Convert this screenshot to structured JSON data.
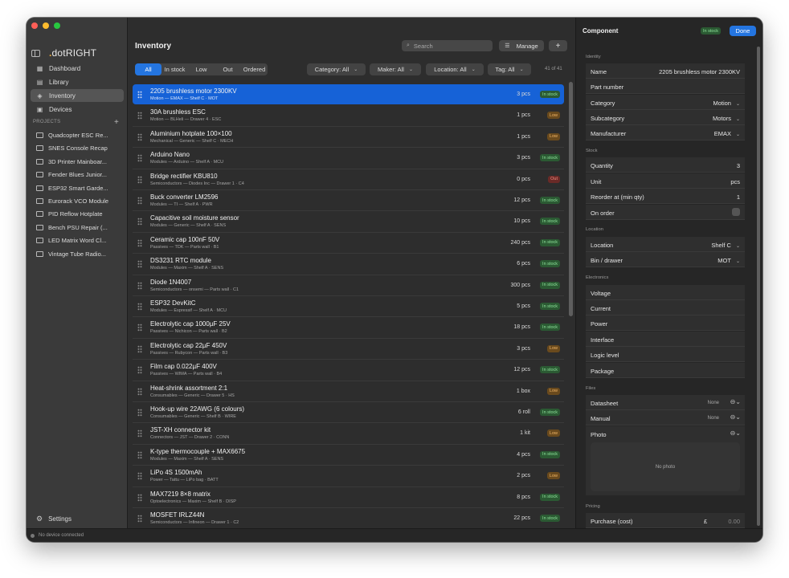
{
  "sidebar": {
    "brand": {
      "prefix": ".",
      "name": "dotRIGHT"
    },
    "nav": [
      {
        "label": "Dashboard",
        "icon": "grid-icon"
      },
      {
        "label": "Library",
        "icon": "book-icon"
      },
      {
        "label": "Inventory",
        "icon": "box-icon",
        "active": true
      },
      {
        "label": "Devices",
        "icon": "chip-icon"
      }
    ],
    "projects_title": "PROJECTS",
    "projects": [
      "Quadcopter ESC Re...",
      "SNES Console Recap",
      "3D Printer Mainboar...",
      "Fender Blues Junior...",
      "ESP32 Smart Garde...",
      "Eurorack VCO Module",
      "PID Reflow Hotplate",
      "Bench PSU Repair (...",
      "LED Matrix Word Cl...",
      "Vintage Tube Radio..."
    ],
    "settings_label": "Settings"
  },
  "status_bar": {
    "text": "No device connected"
  },
  "main": {
    "title": "Inventory",
    "search_placeholder": "Search",
    "manage_label": "Manage",
    "add_label": "+",
    "filter_tabs": [
      "All",
      "In stock",
      "Low",
      "Out",
      "Ordered"
    ],
    "dropdowns": {
      "category": "Category: All",
      "maker": "Maker: All",
      "location": "Location: All",
      "tag": "Tag: All"
    },
    "count": "41 of 41",
    "rows": [
      {
        "name": "2205 brushless motor 2300KV",
        "sub": "Motion — EMAX — Shelf C · MOT",
        "qty": "3 pcs",
        "status": "In stock",
        "kind": "in"
      },
      {
        "name": "30A brushless ESC",
        "sub": "Motion — BLHeli — Drawer 4 · ESC",
        "qty": "1 pcs",
        "status": "Low",
        "kind": "low"
      },
      {
        "name": "Aluminium hotplate 100×100",
        "sub": "Mechanical — Generic — Shelf C · MECH",
        "qty": "1 pcs",
        "status": "Low",
        "kind": "low"
      },
      {
        "name": "Arduino Nano",
        "sub": "Modules — Arduino — Shelf A · MCU",
        "qty": "3 pcs",
        "status": "In stock",
        "kind": "in"
      },
      {
        "name": "Bridge rectifier KBU810",
        "sub": "Semiconductors — Diodes Inc — Drawer 1 · C4",
        "qty": "0 pcs",
        "status": "Out",
        "kind": "out"
      },
      {
        "name": "Buck converter LM2596",
        "sub": "Modules — TI — Shelf A · PWR",
        "qty": "12 pcs",
        "status": "In stock",
        "kind": "in"
      },
      {
        "name": "Capacitive soil moisture sensor",
        "sub": "Modules — Generic — Shelf A · SENS",
        "qty": "10 pcs",
        "status": "In stock",
        "kind": "in"
      },
      {
        "name": "Ceramic cap 100nF 50V",
        "sub": "Passives — TDK — Parts wall · B1",
        "qty": "240 pcs",
        "status": "In stock",
        "kind": "in"
      },
      {
        "name": "DS3231 RTC module",
        "sub": "Modules — Maxim — Shelf A · SENS",
        "qty": "6 pcs",
        "status": "In stock",
        "kind": "in"
      },
      {
        "name": "Diode 1N4007",
        "sub": "Semiconductors — onsemi — Parts wall · C1",
        "qty": "300 pcs",
        "status": "In stock",
        "kind": "in"
      },
      {
        "name": "ESP32 DevKitC",
        "sub": "Modules — Espressif — Shelf A · MCU",
        "qty": "5 pcs",
        "status": "In stock",
        "kind": "in"
      },
      {
        "name": "Electrolytic cap 1000µF 25V",
        "sub": "Passives — Nichicon — Parts wall · B2",
        "qty": "18 pcs",
        "status": "In stock",
        "kind": "in"
      },
      {
        "name": "Electrolytic cap 22µF 450V",
        "sub": "Passives — Rubycon — Parts wall · B3",
        "qty": "3 pcs",
        "status": "Low",
        "kind": "low"
      },
      {
        "name": "Film cap 0.022µF 400V",
        "sub": "Passives — WIMA — Parts wall · B4",
        "qty": "12 pcs",
        "status": "In stock",
        "kind": "in"
      },
      {
        "name": "Heat-shrink assortment 2:1",
        "sub": "Consumables — Generic — Drawer 5 · HS",
        "qty": "1 box",
        "status": "Low",
        "kind": "low"
      },
      {
        "name": "Hook-up wire 22AWG (6 colours)",
        "sub": "Consumables — Generic — Shelf B · WIRE",
        "qty": "6 roll",
        "status": "In stock",
        "kind": "in"
      },
      {
        "name": "JST-XH connector kit",
        "sub": "Connectors — JST — Drawer 2 · CONN",
        "qty": "1 kit",
        "status": "Low",
        "kind": "low"
      },
      {
        "name": "K-type thermocouple + MAX6675",
        "sub": "Modules — Maxim — Shelf A · SENS",
        "qty": "4 pcs",
        "status": "In stock",
        "kind": "in"
      },
      {
        "name": "LiPo 4S 1500mAh",
        "sub": "Power — Tattu — LiPo bag · BATT",
        "qty": "2 pcs",
        "status": "Low",
        "kind": "low"
      },
      {
        "name": "MAX7219 8×8 matrix",
        "sub": "Optoelectronics — Maxim — Shelf B · DISP",
        "qty": "8 pcs",
        "status": "In stock",
        "kind": "in"
      },
      {
        "name": "MOSFET IRLZ44N",
        "sub": "Semiconductors — Infineon — Drawer 1 · C2",
        "qty": "22 pcs",
        "status": "In stock",
        "kind": "in"
      }
    ]
  },
  "inspector": {
    "title": "Component",
    "status": "In stock",
    "done_label": "Done",
    "identity_title": "Identity",
    "name_label": "Name",
    "name_value": "2205 brushless motor 2300KV",
    "part_label": "Part number",
    "category_label": "Category",
    "category_value": "Motion",
    "subcategory_label": "Subcategory",
    "subcategory_value": "Motors",
    "manufacturer_label": "Manufacturer",
    "manufacturer_value": "EMAX",
    "stock_title": "Stock",
    "quantity_label": "Quantity",
    "quantity_value": "3",
    "unit_label": "Unit",
    "unit_value": "pcs",
    "reorder_label": "Reorder at (min qty)",
    "reorder_value": "1",
    "onorder_label": "On order",
    "location_title": "Location",
    "location_label": "Location",
    "location_value": "Shelf C",
    "bin_label": "Bin / drawer",
    "bin_value": "MOT",
    "electronics_title": "Electronics",
    "voltage_label": "Voltage",
    "current_label": "Current",
    "power_label": "Power",
    "interface_label": "Interface",
    "logic_label": "Logic level",
    "package_label": "Package",
    "files_title": "Files",
    "datasheet_label": "Datasheet",
    "datasheet_value": "None",
    "manual_label": "Manual",
    "manual_value": "None",
    "photo_label": "Photo",
    "no_photo": "No photo",
    "pricing_title": "Pricing",
    "purchase_label": "Purchase (cost)",
    "currency": "£",
    "purchase_value": "0.00"
  },
  "colors": {
    "accent": "#2475e0",
    "in_stock": "#8fe39c",
    "low": "#f1b667",
    "out": "#f48c82"
  }
}
